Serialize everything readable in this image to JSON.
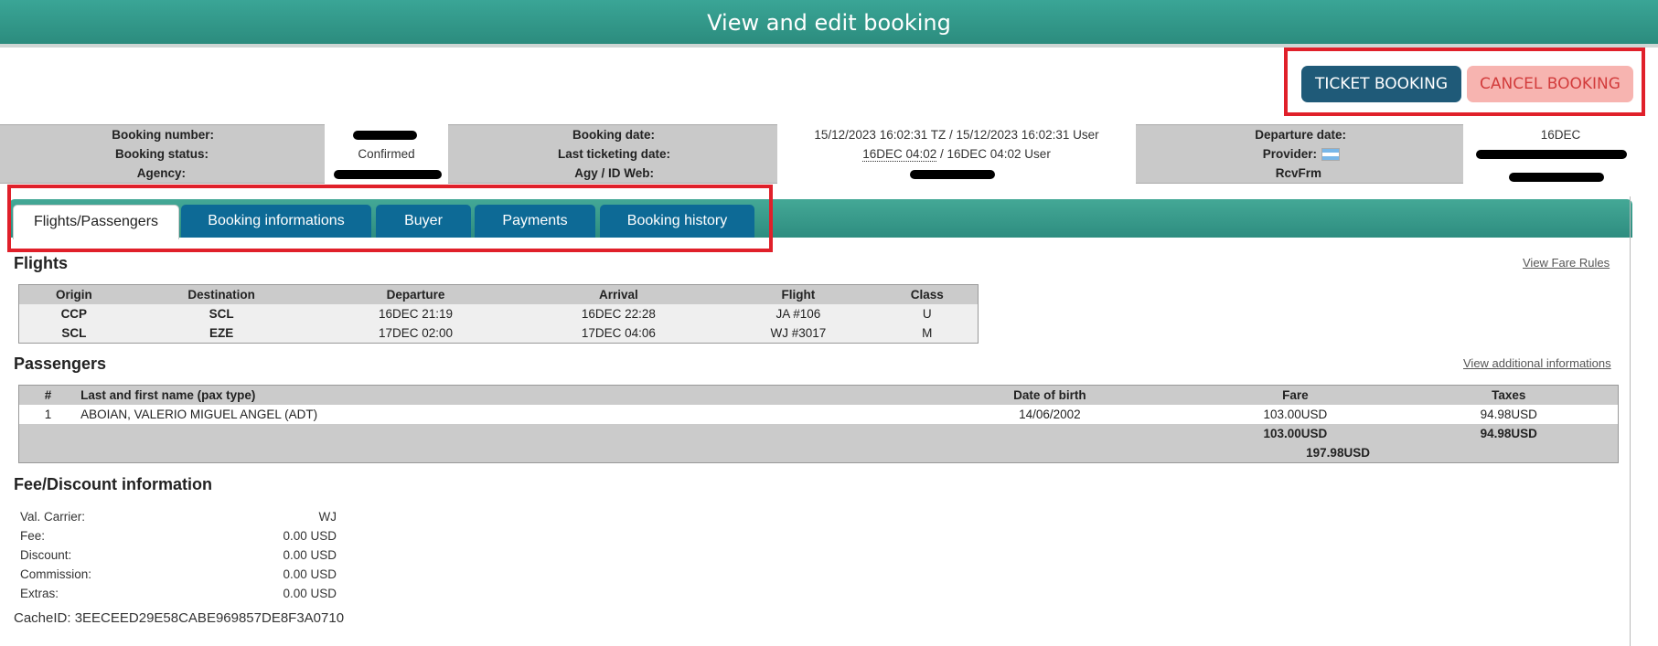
{
  "header": {
    "title": "View and edit booking"
  },
  "actions": {
    "ticket_label": "TICKET BOOKING",
    "cancel_label": "CANCEL BOOKING"
  },
  "booking_info": {
    "booking_number_label": "Booking number:",
    "booking_status_label": "Booking status:",
    "agency_label": "Agency:",
    "booking_status": "Confirmed",
    "booking_date_label": "Booking date:",
    "last_ticketing_label": "Last ticketing date:",
    "agy_id_label": "Agy / ID Web:",
    "booking_date": "15/12/2023 16:02:31 TZ / 15/12/2023 16:02:31 User",
    "last_ticketing_tz": "16DEC 04:02",
    "last_ticketing_user": " / 16DEC 04:02 User",
    "departure_date_label": "Departure date:",
    "provider_label": "Provider:",
    "rcvfrm_label": "RcvFrm",
    "departure_date": "16DEC"
  },
  "tabs": [
    "Flights/Passengers",
    "Booking informations",
    "Buyer",
    "Payments",
    "Booking history"
  ],
  "flights": {
    "title": "Flights",
    "fare_rules_link": "View Fare Rules",
    "columns": [
      "Origin",
      "Destination",
      "Departure",
      "Arrival",
      "Flight",
      "Class"
    ],
    "rows": [
      [
        "CCP",
        "SCL",
        "16DEC 21:19",
        "16DEC 22:28",
        "JA #106",
        "U"
      ],
      [
        "SCL",
        "EZE",
        "17DEC 02:00",
        "17DEC 04:06",
        "WJ #3017",
        "M"
      ]
    ]
  },
  "passengers": {
    "title": "Passengers",
    "additional_link": "View additional informations",
    "columns": [
      "#",
      "Last and first name (pax type)",
      "Date of birth",
      "Fare",
      "Taxes"
    ],
    "rows": [
      [
        "1",
        "ABOIAN, VALERIO MIGUEL ANGEL (ADT)",
        "14/06/2002",
        "103.00USD",
        "94.98USD"
      ]
    ],
    "total_fare": "103.00USD",
    "total_taxes": "94.98USD",
    "grand_total": "197.98USD"
  },
  "fees": {
    "title": "Fee/Discount information",
    "rows": [
      [
        "Val. Carrier:",
        "WJ"
      ],
      [
        "Fee:",
        "0.00 USD"
      ],
      [
        "Discount:",
        "0.00 USD"
      ],
      [
        "Commission:",
        "0.00 USD"
      ],
      [
        "Extras:",
        "0.00 USD"
      ]
    ]
  },
  "cache": "CacheID: 3EECEED29E58CABE969857DE8F3A0710",
  "colors": {
    "header": "#2f9587",
    "tab": "#0d6a96",
    "ticket": "#1f5a78",
    "cancel": "#f7b4b0",
    "highlight": "#e0202a"
  }
}
